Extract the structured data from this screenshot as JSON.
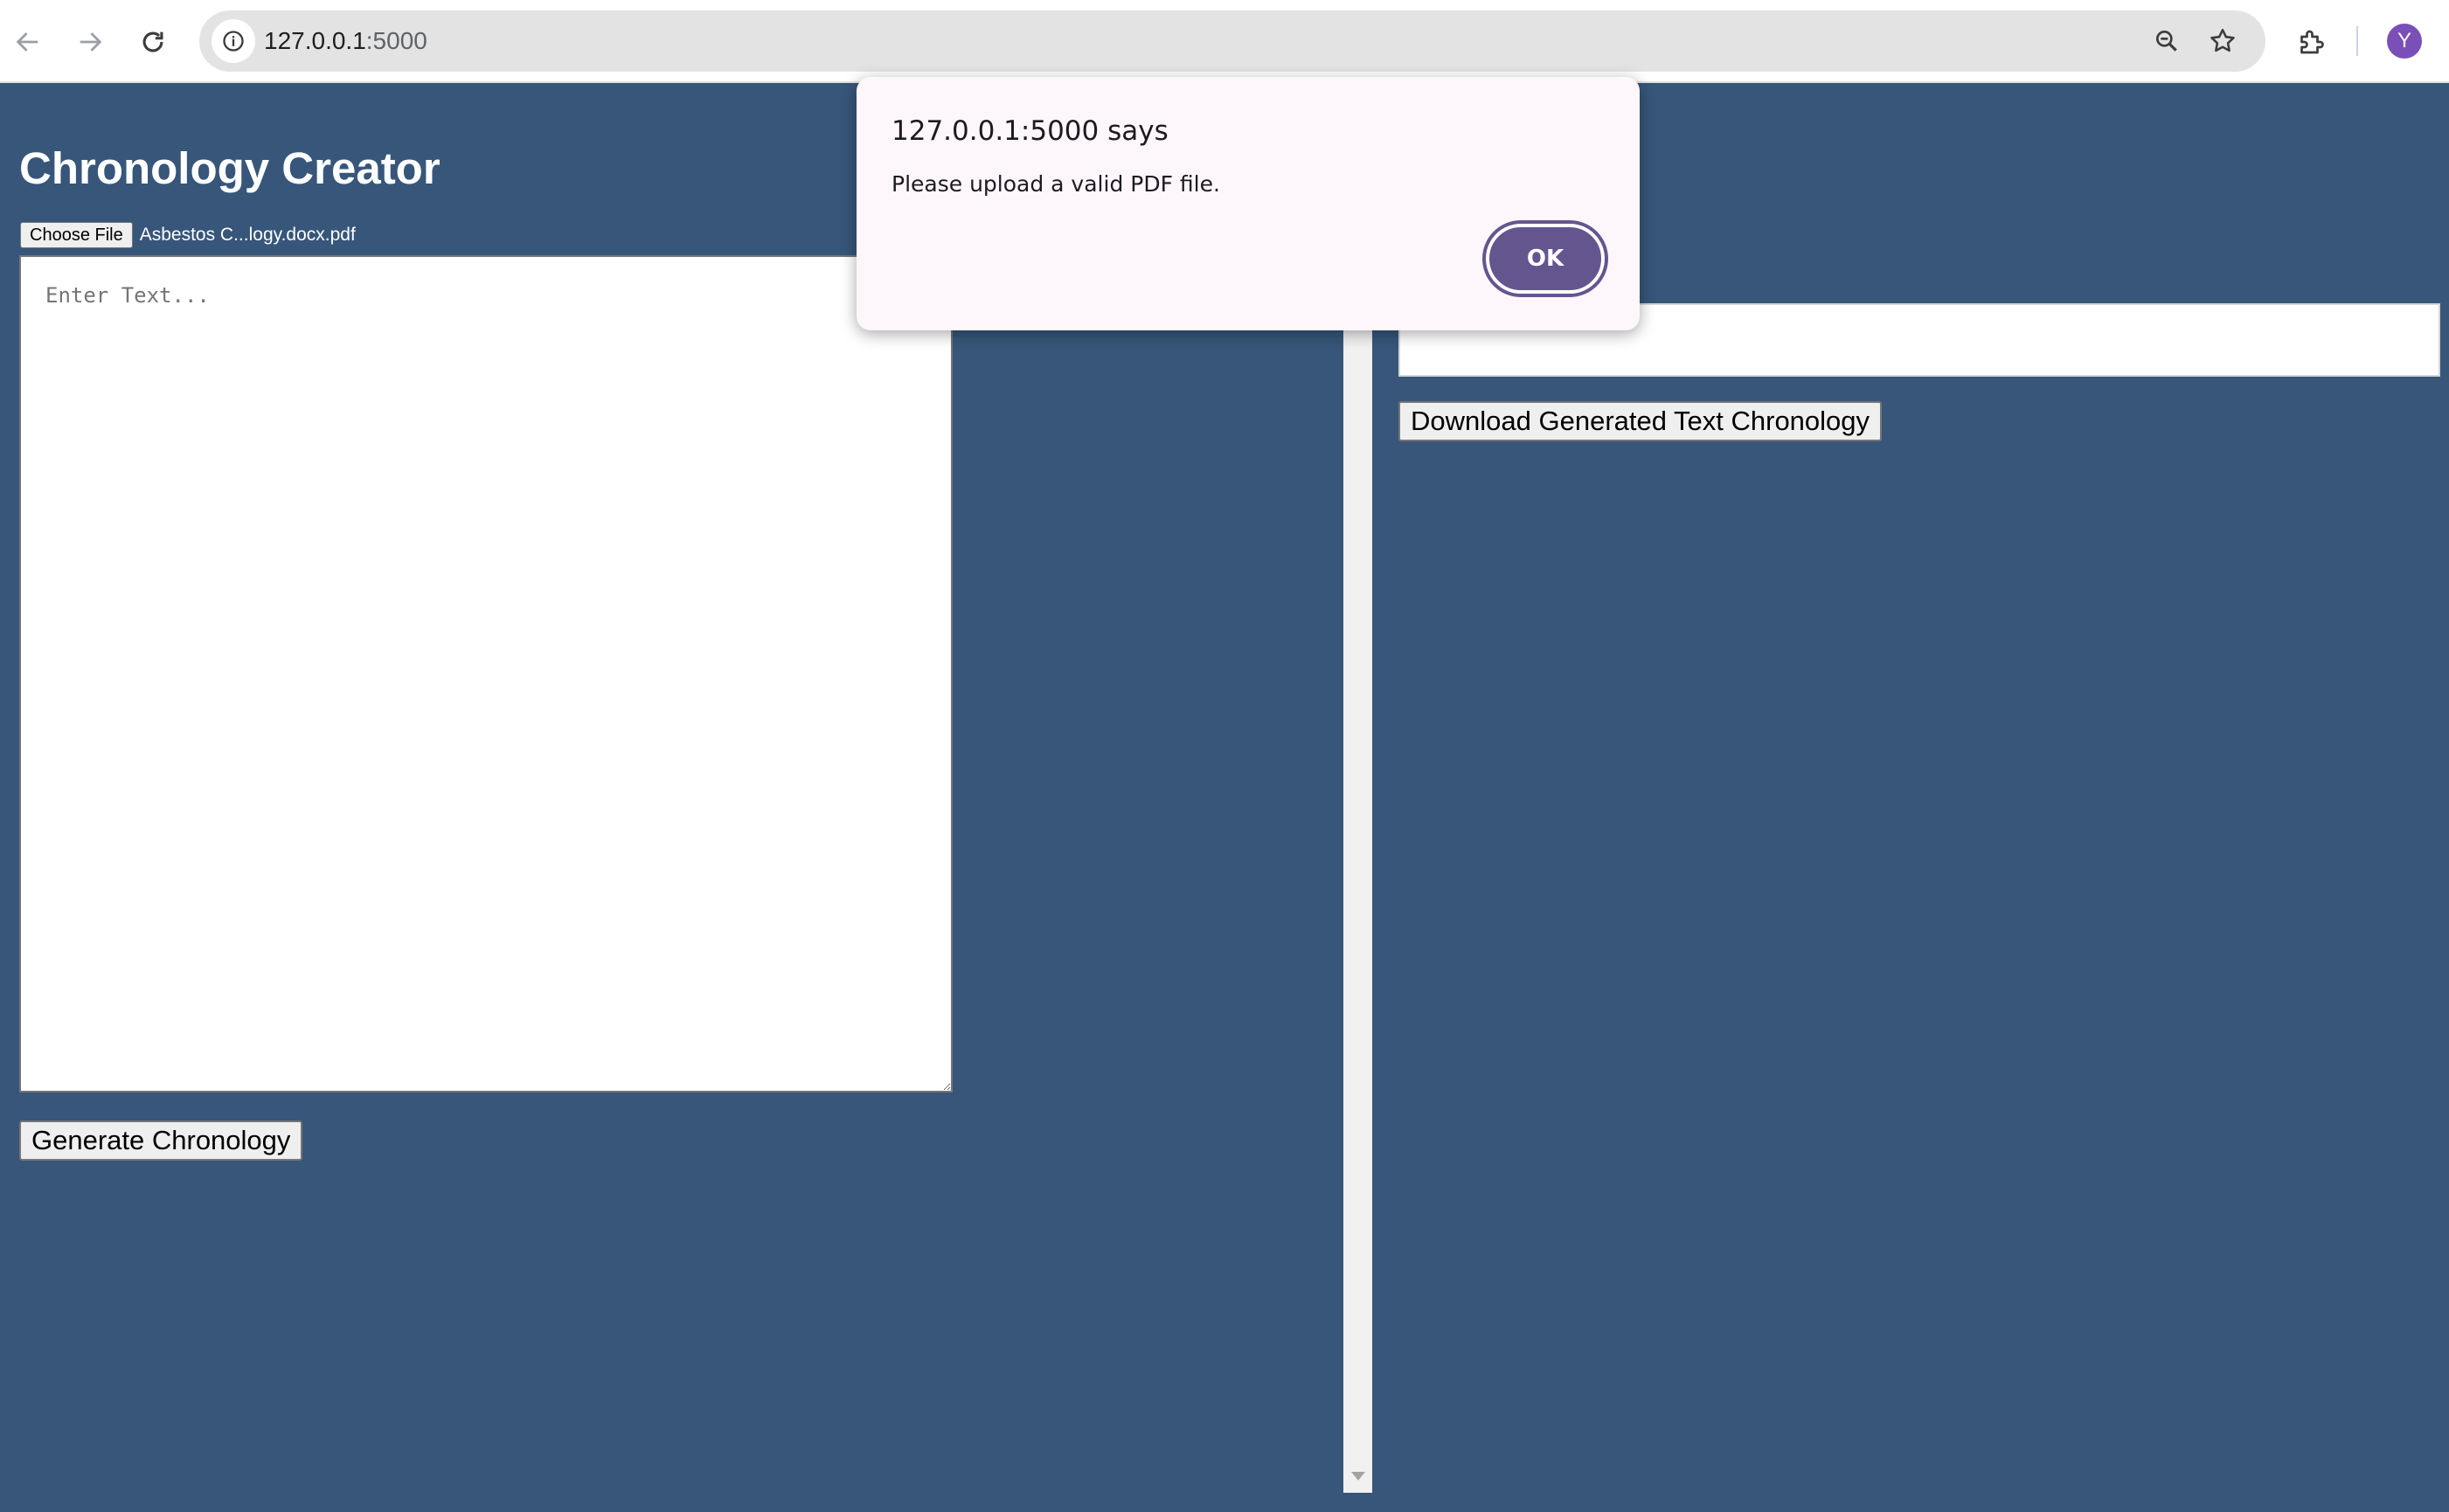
{
  "browser": {
    "url_host": "127.0.0.1",
    "url_port": ":5000",
    "profile_initial": "Y"
  },
  "page": {
    "title": "Chronology Creator",
    "choose_file_label": "Choose File",
    "file_name": "Asbestos C...logy.docx.pdf",
    "text_placeholder": "Enter Text...",
    "generate_label": "Generate Chronology",
    "download_label": "Download Generated Text Chronology"
  },
  "dialog": {
    "title": "127.0.0.1:5000 says",
    "message": "Please upload a valid PDF file.",
    "ok_label": "OK"
  },
  "icons": [
    "back-arrow-icon",
    "forward-arrow-icon",
    "reload-icon",
    "site-info-icon",
    "zoom-icon",
    "bookmark-star-icon",
    "extensions-icon"
  ],
  "colors": {
    "page_background": "#37567a",
    "dialog_button": "#65558f",
    "avatar": "#7b4fb8"
  }
}
